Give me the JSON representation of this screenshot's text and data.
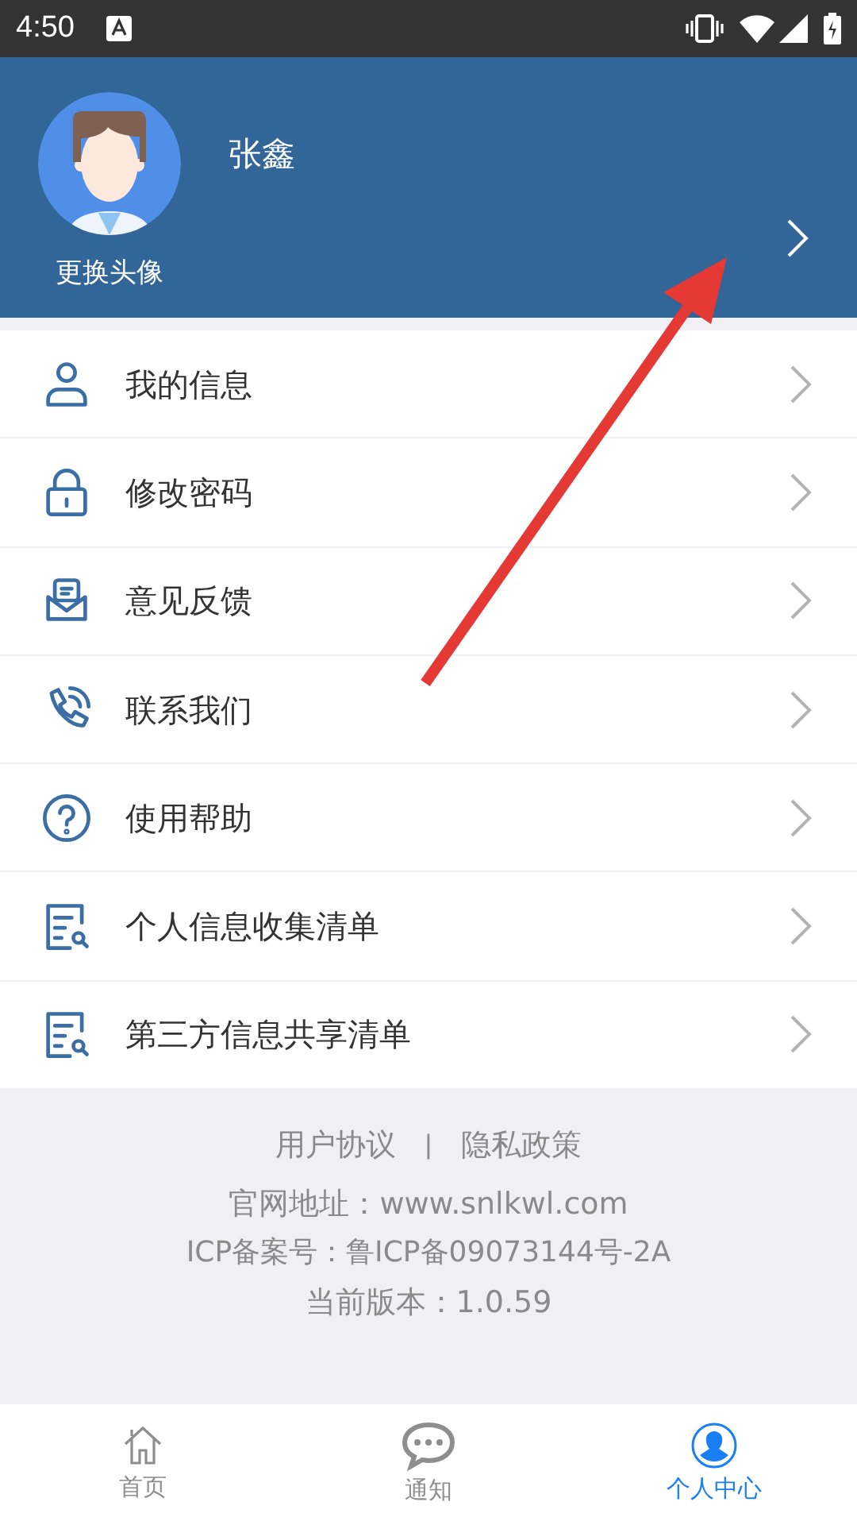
{
  "status_bar": {
    "time": "4:50"
  },
  "profile": {
    "name": "张鑫",
    "change_avatar": "更换头像"
  },
  "menu": [
    {
      "label": "我的信息"
    },
    {
      "label": "修改密码"
    },
    {
      "label": "意见反馈"
    },
    {
      "label": "联系我们"
    },
    {
      "label": "使用帮助"
    },
    {
      "label": "个人信息收集清单"
    },
    {
      "label": "第三方信息共享清单"
    }
  ],
  "footer": {
    "links": [
      "用户协议",
      "隐私政策"
    ],
    "separator": "|",
    "website": "官网地址：www.snlkwl.com",
    "icp": "ICP备案号：鲁ICP备09073144号-2A",
    "version": "当前版本：1.0.59"
  },
  "tabs": [
    {
      "label": "首页",
      "selected": false
    },
    {
      "label": "通知",
      "selected": false
    },
    {
      "label": "个人中心",
      "selected": true
    }
  ]
}
